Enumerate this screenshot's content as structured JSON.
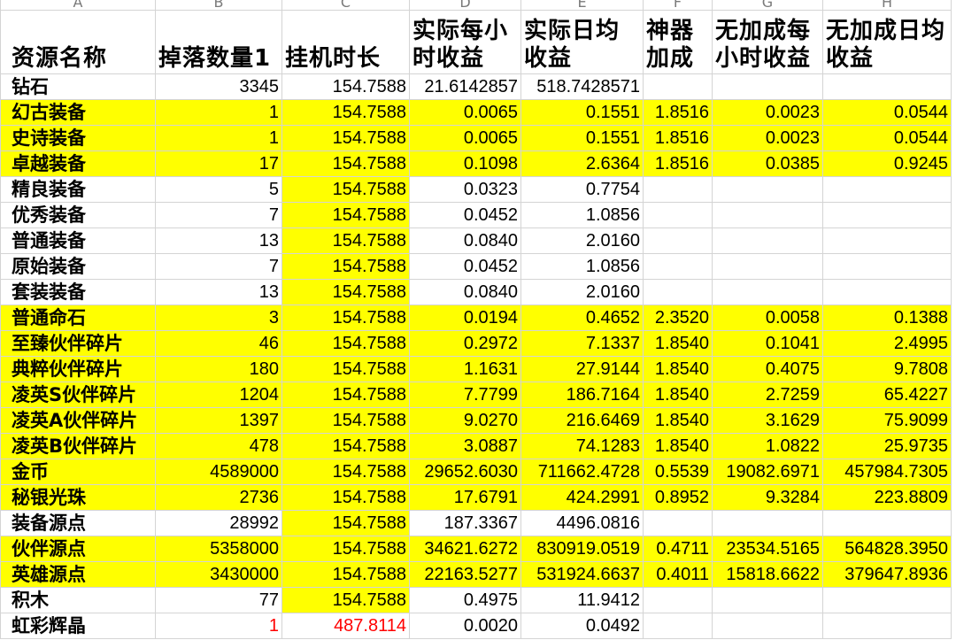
{
  "colors": {
    "highlight": "#ffff00",
    "red_text": "#ff0000",
    "grid": "#d4d4d4"
  },
  "column_letters": [
    "A",
    "B",
    "C",
    "D",
    "E",
    "F",
    "G",
    "H"
  ],
  "headers": [
    "资源名称",
    "掉落数量1",
    "挂机时长",
    "实际每小时收益",
    "实际日均收益",
    "神器加成",
    "无加成每小时收益",
    "无加成日均收益"
  ],
  "rows": [
    {
      "cells": [
        "钻石",
        "3345",
        "154.7588",
        "21.6142857",
        "518.7428571",
        "",
        "",
        ""
      ],
      "highlight": false,
      "c_highlight": false,
      "red": false
    },
    {
      "cells": [
        "幻古装备",
        "1",
        "154.7588",
        "0.0065",
        "0.1551",
        "1.8516",
        "0.0023",
        "0.0544"
      ],
      "highlight": true,
      "c_highlight": true,
      "red": false
    },
    {
      "cells": [
        "史诗装备",
        "1",
        "154.7588",
        "0.0065",
        "0.1551",
        "1.8516",
        "0.0023",
        "0.0544"
      ],
      "highlight": true,
      "c_highlight": true,
      "red": false
    },
    {
      "cells": [
        "卓越装备",
        "17",
        "154.7588",
        "0.1098",
        "2.6364",
        "1.8516",
        "0.0385",
        "0.9245"
      ],
      "highlight": true,
      "c_highlight": true,
      "red": false
    },
    {
      "cells": [
        "精良装备",
        "5",
        "154.7588",
        "0.0323",
        "0.7754",
        "",
        "",
        ""
      ],
      "highlight": false,
      "c_highlight": true,
      "red": false
    },
    {
      "cells": [
        "优秀装备",
        "7",
        "154.7588",
        "0.0452",
        "1.0856",
        "",
        "",
        ""
      ],
      "highlight": false,
      "c_highlight": true,
      "red": false
    },
    {
      "cells": [
        "普通装备",
        "13",
        "154.7588",
        "0.0840",
        "2.0160",
        "",
        "",
        ""
      ],
      "highlight": false,
      "c_highlight": true,
      "red": false
    },
    {
      "cells": [
        "原始装备",
        "7",
        "154.7588",
        "0.0452",
        "1.0856",
        "",
        "",
        ""
      ],
      "highlight": false,
      "c_highlight": true,
      "red": false
    },
    {
      "cells": [
        "套装装备",
        "13",
        "154.7588",
        "0.0840",
        "2.0160",
        "",
        "",
        ""
      ],
      "highlight": false,
      "c_highlight": true,
      "red": false
    },
    {
      "cells": [
        "普通命石",
        "3",
        "154.7588",
        "0.0194",
        "0.4652",
        "2.3520",
        "0.0058",
        "0.1388"
      ],
      "highlight": true,
      "c_highlight": true,
      "red": false
    },
    {
      "cells": [
        "至臻伙伴碎片",
        "46",
        "154.7588",
        "0.2972",
        "7.1337",
        "1.8540",
        "0.1041",
        "2.4995"
      ],
      "highlight": true,
      "c_highlight": true,
      "red": false
    },
    {
      "cells": [
        "典粹伙伴碎片",
        "180",
        "154.7588",
        "1.1631",
        "27.9144",
        "1.8540",
        "0.4075",
        "9.7808"
      ],
      "highlight": true,
      "c_highlight": true,
      "red": false
    },
    {
      "cells": [
        "凌英S伙伴碎片",
        "1204",
        "154.7588",
        "7.7799",
        "186.7164",
        "1.8540",
        "2.7259",
        "65.4227"
      ],
      "highlight": true,
      "c_highlight": true,
      "red": false
    },
    {
      "cells": [
        "凌英A伙伴碎片",
        "1397",
        "154.7588",
        "9.0270",
        "216.6469",
        "1.8540",
        "3.1629",
        "75.9099"
      ],
      "highlight": true,
      "c_highlight": true,
      "red": false
    },
    {
      "cells": [
        "凌英B伙伴碎片",
        "478",
        "154.7588",
        "3.0887",
        "74.1283",
        "1.8540",
        "1.0822",
        "25.9735"
      ],
      "highlight": true,
      "c_highlight": true,
      "red": false
    },
    {
      "cells": [
        "金币",
        "4589000",
        "154.7588",
        "29652.6030",
        "711662.4728",
        "0.5539",
        "19082.6971",
        "457984.7305"
      ],
      "highlight": true,
      "c_highlight": true,
      "red": false
    },
    {
      "cells": [
        "秘银光珠",
        "2736",
        "154.7588",
        "17.6791",
        "424.2991",
        "0.8952",
        "9.3284",
        "223.8809"
      ],
      "highlight": true,
      "c_highlight": true,
      "red": false
    },
    {
      "cells": [
        "装备源点",
        "28992",
        "154.7588",
        "187.3367",
        "4496.0816",
        "",
        "",
        ""
      ],
      "highlight": false,
      "c_highlight": true,
      "red": false
    },
    {
      "cells": [
        "伙伴源点",
        "5358000",
        "154.7588",
        "34621.6272",
        "830919.0519",
        "0.4711",
        "23534.5165",
        "564828.3950"
      ],
      "highlight": true,
      "c_highlight": true,
      "red": false
    },
    {
      "cells": [
        "英雄源点",
        "3430000",
        "154.7588",
        "22163.5277",
        "531924.6637",
        "0.4011",
        "15818.6622",
        "379647.8936"
      ],
      "highlight": true,
      "c_highlight": true,
      "red": false
    },
    {
      "cells": [
        "积木",
        "77",
        "154.7588",
        "0.4975",
        "11.9412",
        "",
        "",
        ""
      ],
      "highlight": false,
      "c_highlight": true,
      "red": false
    },
    {
      "cells": [
        "虹彩辉晶",
        "1",
        "487.8114",
        "0.0020",
        "0.0492",
        "",
        "",
        ""
      ],
      "highlight": false,
      "c_highlight": false,
      "red": true
    }
  ]
}
